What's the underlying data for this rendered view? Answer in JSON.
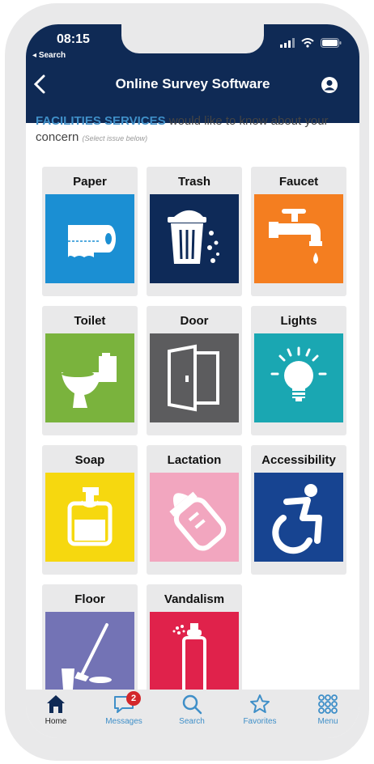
{
  "status_bar": {
    "time": "08:15",
    "back_to": "Search"
  },
  "nav": {
    "title": "Online Survey Software"
  },
  "intro": {
    "brand": "FACILITIES SERVICES",
    "text": " would like to know about your concern",
    "hint": "(Select issue below)"
  },
  "tiles": [
    {
      "label": "Paper",
      "color": "#1b8fd3",
      "icon": "toilet-paper-icon"
    },
    {
      "label": "Trash",
      "color": "#0e2a58",
      "icon": "trash-can-icon"
    },
    {
      "label": "Faucet",
      "color": "#f47e20",
      "icon": "faucet-icon"
    },
    {
      "label": "Toilet",
      "color": "#7ab33d",
      "icon": "toilet-icon"
    },
    {
      "label": "Door",
      "color": "#5c5c5e",
      "icon": "door-icon"
    },
    {
      "label": "Lights",
      "color": "#1aa7b2",
      "icon": "light-bulb-icon"
    },
    {
      "label": "Soap",
      "color": "#f6d80f",
      "icon": "soap-dispenser-icon"
    },
    {
      "label": "Lactation",
      "color": "#f2a6bf",
      "icon": "baby-bottle-icon"
    },
    {
      "label": "Accessibility",
      "color": "#174491",
      "icon": "wheelchair-icon"
    },
    {
      "label": "Floor",
      "color": "#7373b5",
      "icon": "mop-bucket-icon"
    },
    {
      "label": "Vandalism",
      "color": "#e0224b",
      "icon": "spray-can-icon"
    }
  ],
  "tabbar": {
    "home": "Home",
    "messages": "Messages",
    "messages_badge": "2",
    "search": "Search",
    "favorites": "Favorites",
    "menu": "Menu"
  }
}
